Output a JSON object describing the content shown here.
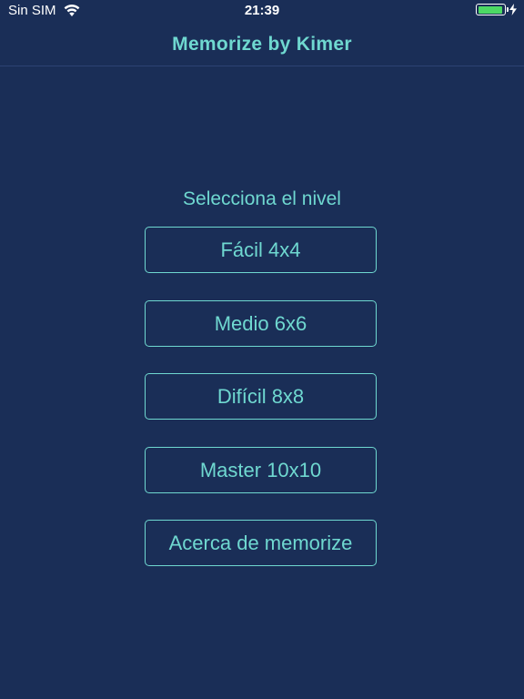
{
  "status_bar": {
    "carrier": "Sin SIM",
    "time": "21:39",
    "wifi_icon": "wifi-icon",
    "battery_icon": "battery-icon",
    "charging_icon": "bolt-icon",
    "battery_color": "#4cd964"
  },
  "nav": {
    "title": "Memorize by Kimer"
  },
  "main": {
    "prompt": "Selecciona el nivel",
    "buttons": [
      {
        "label": "Fácil 4x4"
      },
      {
        "label": "Medio 6x6"
      },
      {
        "label": "Difícil 8x8"
      },
      {
        "label": "Master 10x10"
      },
      {
        "label": "Acerca de memorize"
      }
    ]
  },
  "colors": {
    "background": "#1a2e57",
    "accent": "#6fd8d0",
    "status_text": "#ffffff"
  }
}
